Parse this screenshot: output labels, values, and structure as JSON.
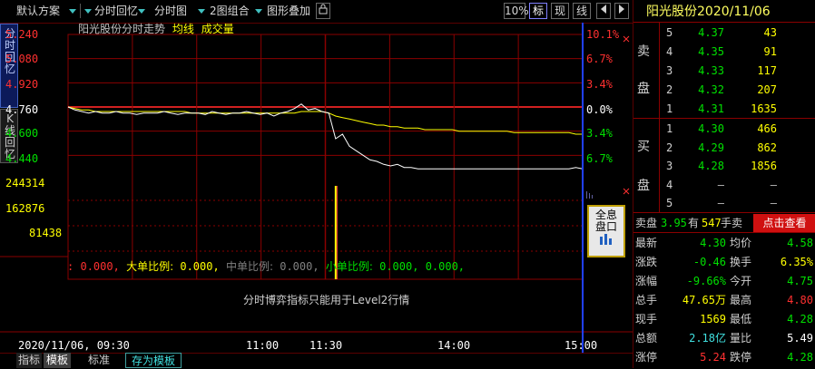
{
  "toolbar": {
    "default_scheme": "默认方案",
    "replay": "分时回忆",
    "chart": "分时图",
    "combo": "2图组合",
    "overlay": "图形叠加",
    "pct": "10%",
    "mark": "标",
    "now": "现",
    "line": "线"
  },
  "side_tabs": {
    "replay": "分时回忆",
    "kline": "K线回忆"
  },
  "chart_header": {
    "title": "阳光股份分时走势",
    "avg": "均线",
    "vol": "成交量"
  },
  "chart_data": {
    "type": "line",
    "prev_close": 4.76,
    "price_ticks": [
      "5.240",
      "5.080",
      "4.920",
      "4.760",
      "4.600",
      "4.440"
    ],
    "pct_ticks_up": [
      "10.1%",
      "6.7%",
      "3.4%",
      "0.0%"
    ],
    "pct_ticks_down": [
      "3.4%",
      "6.7%"
    ],
    "volume_ticks": [
      "244314",
      "162876",
      "81438"
    ],
    "x_ticks": [
      "2020/11/06, 09:30",
      "11:00",
      "11:30",
      "14:00",
      "15:00"
    ],
    "ylim": [
      4.28,
      5.24
    ],
    "price_series": [
      4.76,
      4.74,
      4.73,
      4.72,
      4.73,
      4.72,
      4.72,
      4.73,
      4.72,
      4.72,
      4.71,
      4.72,
      4.72,
      4.72,
      4.73,
      4.72,
      4.71,
      4.72,
      4.72,
      4.72,
      4.71,
      4.73,
      4.72,
      4.71,
      4.72,
      4.72,
      4.73,
      4.72,
      4.71,
      4.72,
      4.7,
      4.72,
      4.73,
      4.75,
      4.78,
      4.74,
      4.75,
      4.73,
      4.72,
      4.55,
      4.58,
      4.5,
      4.47,
      4.44,
      4.41,
      4.4,
      4.38,
      4.37,
      4.38,
      4.36,
      4.36,
      4.35,
      4.35,
      4.35,
      4.35,
      4.35,
      4.35,
      4.35,
      4.35,
      4.35,
      4.35,
      4.35,
      4.35,
      4.35,
      4.35,
      4.35,
      4.35,
      4.35,
      4.35,
      4.35,
      4.35,
      4.35,
      4.35,
      4.35,
      4.36,
      4.35
    ],
    "avg_series": [
      4.76,
      4.75,
      4.74,
      4.74,
      4.73,
      4.73,
      4.73,
      4.73,
      4.73,
      4.73,
      4.73,
      4.73,
      4.73,
      4.73,
      4.73,
      4.73,
      4.73,
      4.73,
      4.72,
      4.72,
      4.72,
      4.72,
      4.72,
      4.72,
      4.72,
      4.72,
      4.72,
      4.72,
      4.72,
      4.72,
      4.72,
      4.72,
      4.72,
      4.72,
      4.73,
      4.73,
      4.73,
      4.73,
      4.72,
      4.7,
      4.69,
      4.68,
      4.67,
      4.66,
      4.65,
      4.64,
      4.64,
      4.63,
      4.63,
      4.62,
      4.62,
      4.62,
      4.61,
      4.61,
      4.61,
      4.61,
      4.61,
      4.6,
      4.6,
      4.6,
      4.6,
      4.6,
      4.6,
      4.6,
      4.6,
      4.59,
      4.59,
      4.59,
      4.59,
      4.59,
      4.59,
      4.59,
      4.59,
      4.59,
      4.58,
      4.58
    ]
  },
  "ratios": {
    "big_label": "大单比例:",
    "mid_label": "中单比例:",
    "small_label": "小单比例:",
    "v0": "0.000,",
    "v1": "0.000,",
    "v2": "0.000,",
    "v3": "0.000,",
    "v4": "0.000,"
  },
  "level2_msg": "分时博弈指标只能用于Level2行情",
  "full_panel_btn": "全息盘口",
  "bottom_tabs": {
    "t1": "指标",
    "t2": "模板",
    "t3": "标准",
    "t4": "存为模板"
  },
  "quote": {
    "title": "阳光股份2020/11/06",
    "sell_label": "卖",
    "sell_label2": "盘",
    "buy_label": "买",
    "buy_label2": "盘",
    "sells": [
      {
        "lvl": "5",
        "price": "4.37",
        "vol": "43"
      },
      {
        "lvl": "4",
        "price": "4.35",
        "vol": "91"
      },
      {
        "lvl": "3",
        "price": "4.33",
        "vol": "117"
      },
      {
        "lvl": "2",
        "price": "4.32",
        "vol": "207"
      },
      {
        "lvl": "1",
        "price": "4.31",
        "vol": "1635"
      }
    ],
    "buys": [
      {
        "lvl": "1",
        "price": "4.30",
        "vol": "466"
      },
      {
        "lvl": "2",
        "price": "4.29",
        "vol": "862"
      },
      {
        "lvl": "3",
        "price": "4.28",
        "vol": "1856"
      },
      {
        "lvl": "4",
        "price": "—",
        "vol": "—"
      },
      {
        "lvl": "5",
        "price": "—",
        "vol": "—"
      }
    ],
    "sell_summary": {
      "a": "卖盘",
      "p": "3.95",
      "b": "有",
      "v": "547",
      "c": "手卖",
      "link": "点击查看"
    },
    "stats": [
      {
        "k1": "最新",
        "v1": "4.30",
        "c1": "green",
        "k2": "均价",
        "v2": "4.58",
        "c2": "green"
      },
      {
        "k1": "涨跌",
        "v1": "-0.46",
        "c1": "green",
        "k2": "换手",
        "v2": "6.35%",
        "c2": "yellow"
      },
      {
        "k1": "涨幅",
        "v1": "-9.66%",
        "c1": "green",
        "k2": "今开",
        "v2": "4.75",
        "c2": "green"
      },
      {
        "k1": "总手",
        "v1": "47.65万",
        "c1": "yellow",
        "k2": "最高",
        "v2": "4.80",
        "c2": "red"
      },
      {
        "k1": "现手",
        "v1": "1569",
        "c1": "yellow",
        "k2": "最低",
        "v2": "4.28",
        "c2": "green"
      },
      {
        "k1": "总额",
        "v1": "2.18亿",
        "c1": "cyan",
        "k2": "量比",
        "v2": "5.49",
        "c2": "white"
      },
      {
        "k1": "涨停",
        "v1": "5.24",
        "c1": "red",
        "k2": "跌停",
        "v2": "4.28",
        "c2": "green"
      }
    ]
  }
}
